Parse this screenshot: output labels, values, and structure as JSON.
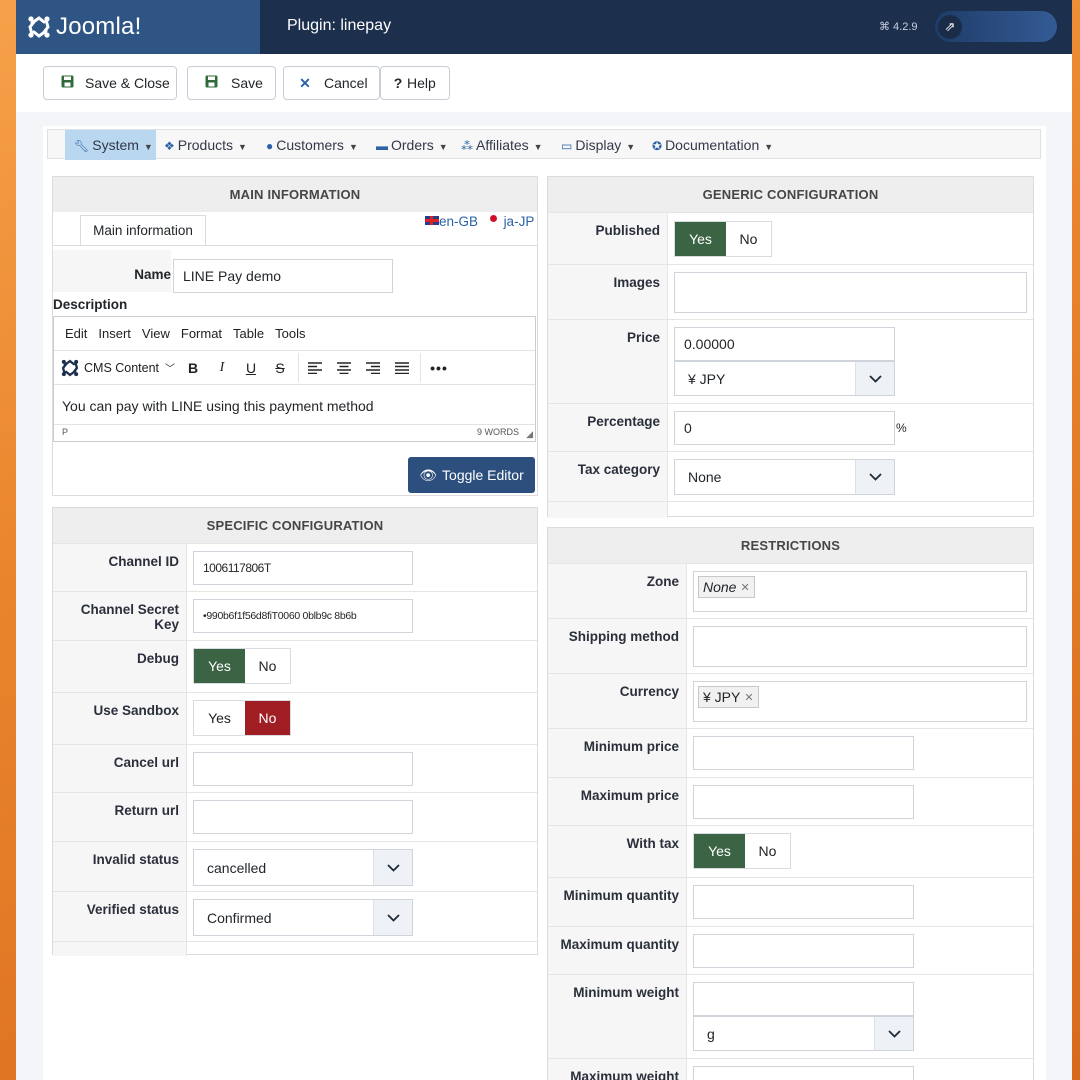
{
  "header": {
    "logo_text": "Joomla!",
    "title": "Plugin: linepay",
    "version": "⌘ 4.2.9"
  },
  "toolbar": {
    "save_close": "Save & Close",
    "save": "Save",
    "cancel": "Cancel",
    "help": "Help"
  },
  "nav": {
    "items": [
      {
        "label": "System",
        "icon": "wrench-icon"
      },
      {
        "label": "Products",
        "icon": "cubes-icon"
      },
      {
        "label": "Customers",
        "icon": "user-icon"
      },
      {
        "label": "Orders",
        "icon": "credit-card-icon"
      },
      {
        "label": "Affiliates",
        "icon": "users-icon"
      },
      {
        "label": "Display",
        "icon": "monitor-icon"
      },
      {
        "label": "Documentation",
        "icon": "lifebuoy-icon"
      }
    ]
  },
  "main_info": {
    "heading": "MAIN INFORMATION",
    "tab": "Main information",
    "lang1": "en-GB",
    "lang2": "ja-JP",
    "name_label": "Name",
    "name_value": "LINE Pay demo",
    "description_label": "Description",
    "editor_menu": [
      "Edit",
      "Insert",
      "View",
      "Format",
      "Table",
      "Tools"
    ],
    "editor_block": "CMS Content",
    "editor_text": "You can pay with LINE using this payment method",
    "status_path": "P",
    "word_count": "9 WORDS",
    "toggle_editor": "Toggle Editor"
  },
  "specific": {
    "heading": "SPECIFIC CONFIGURATION",
    "channel_id_label": "Channel ID",
    "channel_id_value": "1006117806T",
    "channel_secret_label": "Channel Secret Key",
    "channel_secret_value": "•990b6f1f56d8fiT0060 0blb9c 8b6b",
    "debug_label": "Debug",
    "sandbox_label": "Use Sandbox",
    "cancel_url_label": "Cancel url",
    "return_url_label": "Return url",
    "invalid_status_label": "Invalid status",
    "invalid_status_value": "cancelled",
    "verified_status_label": "Verified status",
    "verified_status_value": "Confirmed",
    "yes": "Yes",
    "no": "No"
  },
  "generic": {
    "heading": "GENERIC CONFIGURATION",
    "published_label": "Published",
    "images_label": "Images",
    "price_label": "Price",
    "price_value": "0.00000",
    "currency_value": "¥ JPY",
    "percentage_label": "Percentage",
    "percentage_value": "0",
    "percent_sign": "%",
    "tax_label": "Tax category",
    "tax_value": "None",
    "yes": "Yes",
    "no": "No"
  },
  "restrictions": {
    "heading": "RESTRICTIONS",
    "zone_label": "Zone",
    "zone_tag": "None",
    "shipping_label": "Shipping method",
    "currency_label": "Currency",
    "currency_tag": "¥ JPY",
    "min_price_label": "Minimum price",
    "max_price_label": "Maximum price",
    "with_tax_label": "With tax",
    "min_qty_label": "Minimum quantity",
    "max_qty_label": "Maximum quantity",
    "min_weight_label": "Minimum weight",
    "weight_unit": "g",
    "max_weight_label": "Maximum weight",
    "yes": "Yes",
    "no": "No"
  }
}
